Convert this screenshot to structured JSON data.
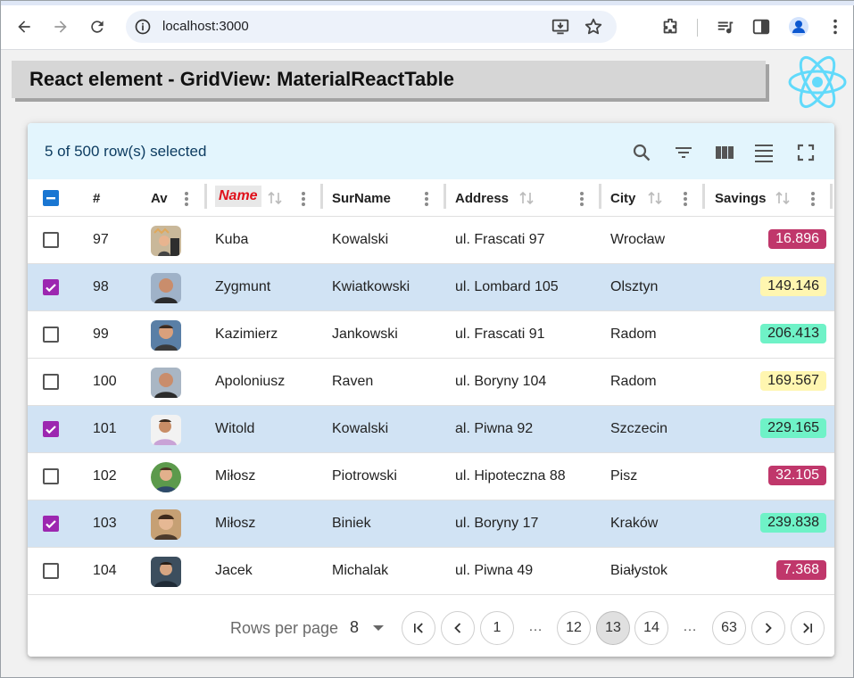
{
  "browser": {
    "url": "localhost:3000",
    "icons": [
      "back-icon",
      "forward-icon",
      "reload-icon",
      "info-icon",
      "install-icon",
      "star-icon",
      "extensions-icon",
      "media-icon",
      "side-panel-icon",
      "profile-icon",
      "menu-icon"
    ]
  },
  "page": {
    "title": "React element - GridView: MaterialReactTable"
  },
  "table": {
    "selection_text": "5 of 500 row(s) selected",
    "toolbar_icons": [
      "search-icon",
      "filter-icon",
      "columns-icon",
      "density-icon",
      "fullscreen-icon"
    ],
    "columns": {
      "num": "#",
      "avatar": "Av",
      "name": "Name",
      "surname": "SurName",
      "address": "Address",
      "city": "City",
      "savings": "Savings"
    },
    "rows": [
      {
        "num": "97",
        "name": "Kuba",
        "surname": "Kowalski",
        "address": "ul. Frascati 97",
        "city": "Wrocław",
        "savings": "16.896",
        "level": "low",
        "selected": false
      },
      {
        "num": "98",
        "name": "Zygmunt",
        "surname": "Kwiatkowski",
        "address": "ul. Lombard 105",
        "city": "Olsztyn",
        "savings": "149.146",
        "level": "mid",
        "selected": true
      },
      {
        "num": "99",
        "name": "Kazimierz",
        "surname": "Jankowski",
        "address": "ul. Frascati 91",
        "city": "Radom",
        "savings": "206.413",
        "level": "high",
        "selected": false
      },
      {
        "num": "100",
        "name": "Apoloniusz",
        "surname": "Raven",
        "address": "ul. Boryny 104",
        "city": "Radom",
        "savings": "169.567",
        "level": "mid",
        "selected": false
      },
      {
        "num": "101",
        "name": "Witold",
        "surname": "Kowalski",
        "address": "al. Piwna 92",
        "city": "Szczecin",
        "savings": "229.165",
        "level": "high",
        "selected": true
      },
      {
        "num": "102",
        "name": "Miłosz",
        "surname": "Piotrowski",
        "address": "ul. Hipoteczna 88",
        "city": "Pisz",
        "savings": "32.105",
        "level": "low",
        "selected": false
      },
      {
        "num": "103",
        "name": "Miłosz",
        "surname": "Biniek",
        "address": "ul. Boryny 17",
        "city": "Kraków",
        "savings": "239.838",
        "level": "high",
        "selected": true
      },
      {
        "num": "104",
        "name": "Jacek",
        "surname": "Michalak",
        "address": "ul. Piwna 49",
        "city": "Białystok",
        "savings": "7.368",
        "level": "low",
        "selected": false
      }
    ],
    "pagination": {
      "rows_per_page_label": "Rows per page",
      "rows_per_page": "8",
      "pages": [
        "1",
        "…",
        "12",
        "13",
        "14",
        "…",
        "63"
      ],
      "current_page": "13"
    }
  },
  "colors": {
    "toolbar_bg": "#e3f5fd",
    "selected_row": "#d1e3f4",
    "checkbox_checked": "#9c27b0",
    "checkbox_indeterminate": "#1976d2",
    "savings_low": "#c0376b",
    "savings_mid": "#fff6b0",
    "savings_high": "#6ff2c7",
    "react_blue": "#61dafb"
  }
}
